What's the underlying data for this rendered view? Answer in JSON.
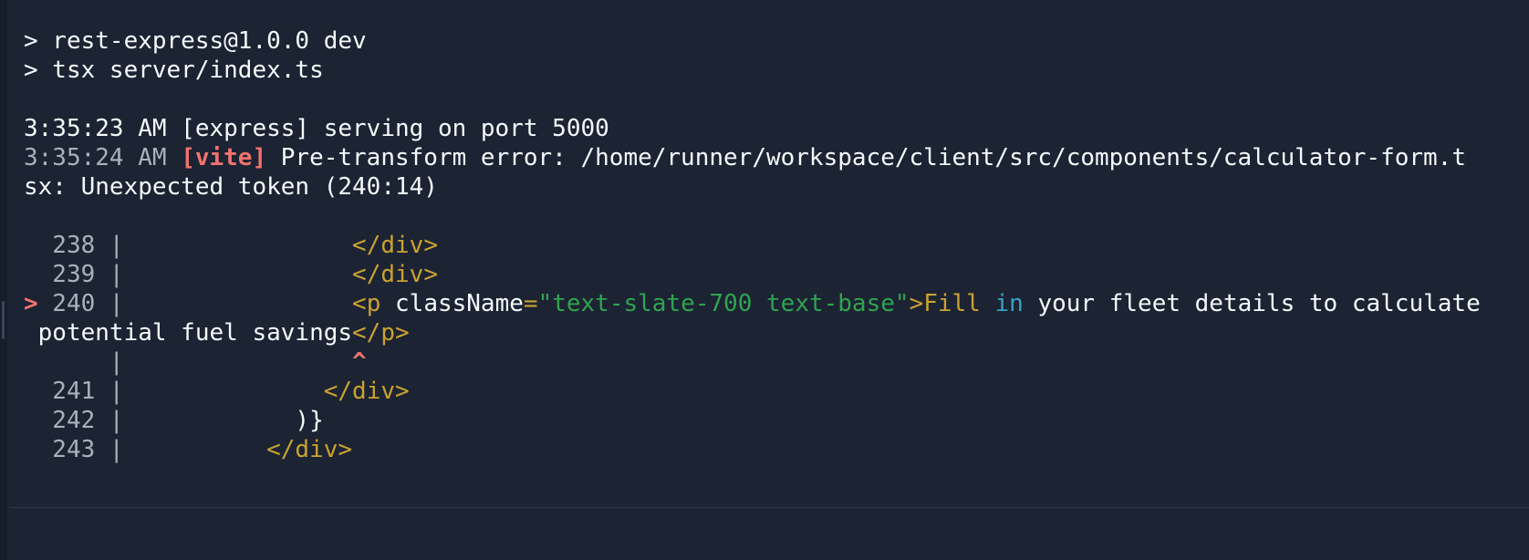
{
  "terminal": {
    "lines": {
      "cmd1": "> rest-express@1.0.0 dev",
      "cmd2": "> tsx server/index.ts",
      "log1": "3:35:23 AM [express] serving on port 5000",
      "log2_time": "3:35:24 AM ",
      "log2_tag": "[vite]",
      "log2_msg": " Pre-transform error: /home/runner/workspace/client/src/components/calculator-form.t",
      "log2_wrap": "sx: Unexpected token (240:14)"
    },
    "code_frame": {
      "rows": [
        {
          "gutter": "  238 | ",
          "indent": "               ",
          "code": "</div>"
        },
        {
          "gutter": "  239 | ",
          "indent": "               ",
          "code": "</div>"
        },
        {
          "gutter": "> 240 | ",
          "indent": "               "
        },
        {
          "gutter": "      | ",
          "indent": "               ",
          "caret": "^"
        },
        {
          "gutter": "  241 | ",
          "indent": "             ",
          "code": "</div>"
        },
        {
          "gutter": "  242 | ",
          "indent": "           ",
          "code": ")}"
        },
        {
          "gutter": "  243 | ",
          "indent": "         ",
          "code": "</div>"
        }
      ],
      "line240": {
        "open": "<p",
        "attr": " className",
        "eq": "=",
        "str": "\"text-slate-700 text-base\"",
        "close": ">",
        "word1": "Fill",
        "kw": " in",
        "rest": " your fleet details to calculate",
        "wrap_text": " potential fuel savings",
        "end_tag": "</p>"
      }
    }
  },
  "colors": {
    "background": "#1c2333",
    "text": "#f5f9fc",
    "dim": "#a8b0bd",
    "error": "#f0736f",
    "jsx_tag": "#c9a231",
    "string": "#2ea44f",
    "keyword": "#39a0c4"
  }
}
